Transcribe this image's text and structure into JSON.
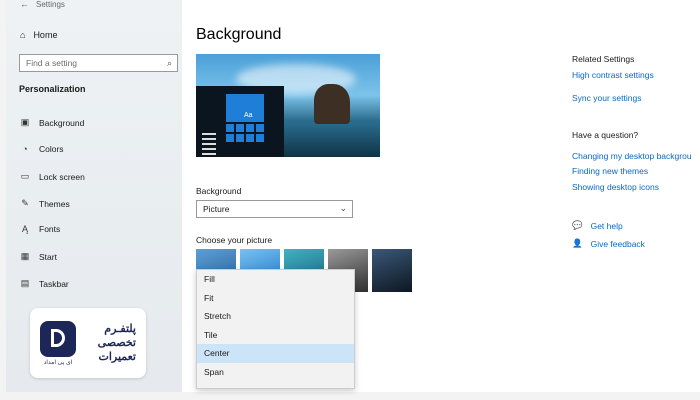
{
  "window": {
    "title": "Settings"
  },
  "sidebar": {
    "home_label": "Home",
    "search_placeholder": "Find a setting",
    "section_title": "Personalization",
    "items": [
      {
        "label": "Background",
        "icon": "picture-icon"
      },
      {
        "label": "Colors",
        "icon": "palette-icon"
      },
      {
        "label": "Lock screen",
        "icon": "lock-screen-icon"
      },
      {
        "label": "Themes",
        "icon": "brush-icon"
      },
      {
        "label": "Fonts",
        "icon": "fonts-icon"
      },
      {
        "label": "Start",
        "icon": "start-icon"
      },
      {
        "label": "Taskbar",
        "icon": "taskbar-icon"
      }
    ]
  },
  "watermark": {
    "line1": "پلتفـرم",
    "line2": "تخصصی",
    "line3": "تعمیرات",
    "sub": "ای پی امداد"
  },
  "main": {
    "title": "Background",
    "preview_tile_label": "Aa",
    "background_label": "Background",
    "background_value": "Picture",
    "choose_label": "Choose your picture",
    "fit_options": [
      "Fill",
      "Fit",
      "Stretch",
      "Tile",
      "Center",
      "Span"
    ],
    "selected_fit": "Center",
    "thumbnail_colors": [
      "#5f9fd8",
      "#2c8ad6",
      "#2a7fa8",
      "#6b6b6b",
      "#1b2a3a"
    ]
  },
  "related": {
    "title": "Related Settings",
    "links": [
      "High contrast settings",
      "Sync your settings"
    ],
    "question_title": "Have a question?",
    "question_links": [
      "Changing my desktop backgrou",
      "Finding new themes",
      "Showing desktop icons"
    ],
    "get_help": "Get help",
    "give_feedback": "Give feedback"
  }
}
